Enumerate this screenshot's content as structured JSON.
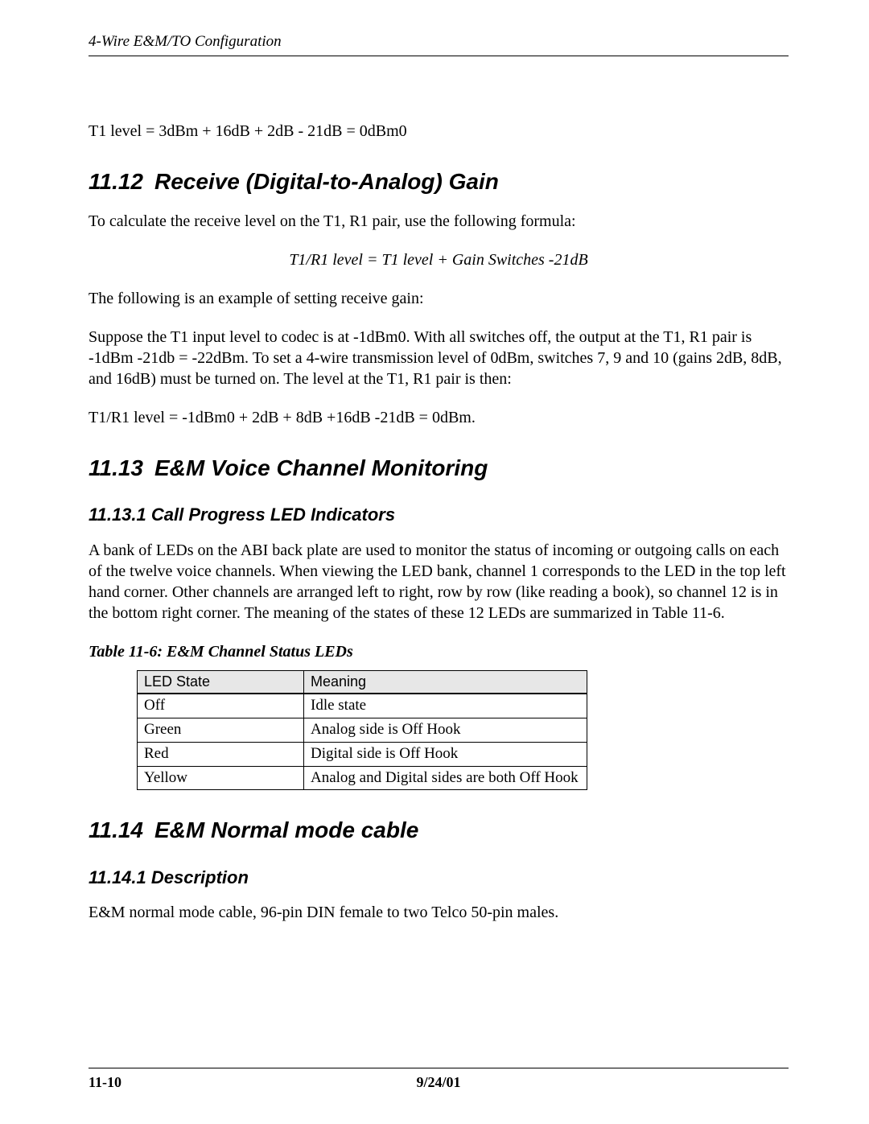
{
  "header": {
    "running_title": "4-Wire E&M/TO Configuration"
  },
  "body": {
    "t1_level_equation": "T1 level = 3dBm + 16dB + 2dB - 21dB = 0dBm0"
  },
  "sec12": {
    "heading_no": "11.12",
    "heading_text": "Receive (Digital-to-Analog) Gain",
    "intro": "To calculate the receive level on the T1, R1 pair, use the following formula:",
    "formula": "T1/R1 level = T1 level + Gain Switches -21dB",
    "following_intro": "The following is an example of setting receive gain:",
    "example_para": "Suppose the T1 input level to codec is at -1dBm0. With all switches off, the output at the T1, R1 pair is -1dBm -21db = -22dBm. To set a 4-wire transmission level of 0dBm, switches 7, 9 and 10 (gains 2dB, 8dB, and 16dB) must be turned on. The level at the T1, R1 pair is then:",
    "example_equation": "T1/R1 level = -1dBm0 + 2dB + 8dB +16dB -21dB = 0dBm."
  },
  "sec13": {
    "heading_no": "11.13",
    "heading_text": "E&M Voice Channel Monitoring",
    "sub1_heading": "11.13.1 Call Progress LED Indicators",
    "sub1_para": "A bank of LEDs on the ABI back plate are used to monitor the status of incoming or outgoing calls on each of the twelve voice channels. When viewing the LED bank, channel 1 corresponds to the LED in the top left hand corner. Other channels are arranged left to right, row by row (like reading a book), so channel 12 is in the bottom right corner. The meaning of the states of these 12 LEDs are summarized in Table 11-6.",
    "table_caption": "Table 11-6: E&M Channel Status LEDs",
    "table": {
      "headers": [
        "LED State",
        "Meaning"
      ],
      "rows": [
        [
          "Off",
          "Idle state"
        ],
        [
          "Green",
          "Analog side is Off Hook"
        ],
        [
          "Red",
          "Digital side is Off Hook"
        ],
        [
          "Yellow",
          "Analog and Digital sides are both Off Hook"
        ]
      ]
    }
  },
  "sec14": {
    "heading_no": "11.14",
    "heading_text": "E&M Normal mode cable",
    "sub1_heading": "11.14.1 Description",
    "sub1_para": "E&M normal mode cable, 96-pin DIN female to two Telco 50-pin males."
  },
  "footer": {
    "page": "11-10",
    "date": "9/24/01"
  }
}
